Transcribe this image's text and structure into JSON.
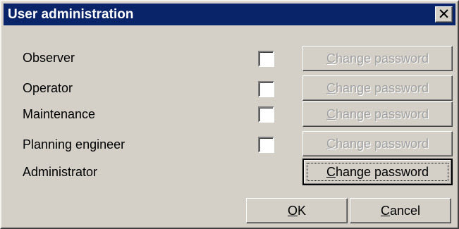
{
  "window": {
    "title": "User administration",
    "close_glyph": "✕"
  },
  "rows": [
    {
      "label": "Observer",
      "checked": false,
      "button": {
        "mnemonic": "C",
        "rest": "hange password",
        "enabled": false
      }
    },
    {
      "label": "Operator",
      "checked": false,
      "button": {
        "mnemonic": "C",
        "rest": "hange password",
        "enabled": false
      }
    },
    {
      "label": "Maintenance",
      "checked": false,
      "button": {
        "mnemonic": "C",
        "rest": "hange password",
        "enabled": false
      }
    },
    {
      "label": "Planning engineer",
      "checked": false,
      "button": {
        "mnemonic": "C",
        "rest": "hange password",
        "enabled": false
      }
    },
    {
      "label": "Administrator",
      "button": {
        "mnemonic": "C",
        "rest": "hange password",
        "enabled": true,
        "focused": true
      }
    }
  ],
  "footer": {
    "ok": {
      "mnemonic": "O",
      "rest": "K"
    },
    "cancel": {
      "mnemonic": "C",
      "rest": "ancel"
    }
  },
  "colors": {
    "title_bar": "#0a246a",
    "face": "#d4d0c8",
    "disabled_text": "#a0a0a0"
  }
}
